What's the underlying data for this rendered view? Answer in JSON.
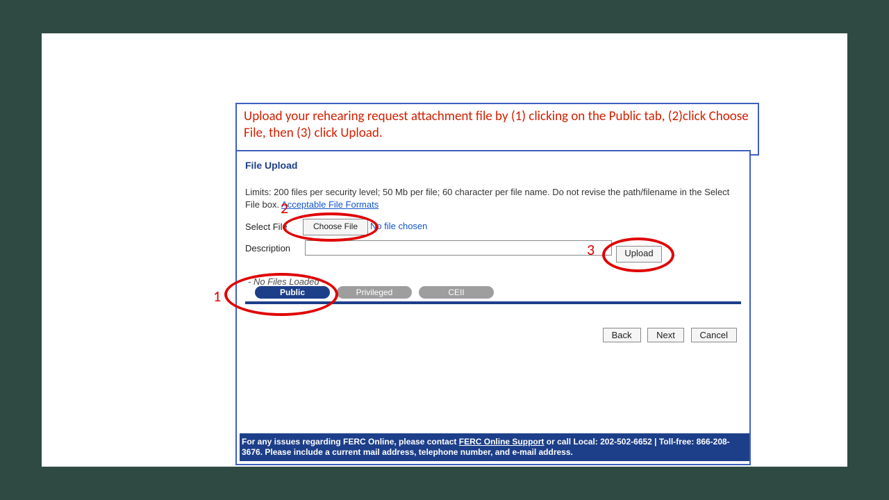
{
  "instruction": "Upload your rehearing request attachment file by (1) clicking on the Public tab, (2)click Choose File, then (3) click Upload.",
  "panel": {
    "title": "File Upload",
    "limits_prefix": "Limits: 200 files per security level; 50 Mb per file; 60 character per file name. Do not revise the path/filename in the Select File box. ",
    "acceptable_link": "Acceptable File Formats",
    "select_file_label": "Select File",
    "choose_file_btn": "Choose File",
    "no_file_text": "No file chosen",
    "description_label": "Description",
    "upload_btn": "Upload",
    "no_files_loaded": "- No Files Loaded -",
    "tabs": {
      "public": "Public",
      "privileged": "Privileged",
      "ceii": "CEII"
    },
    "nav": {
      "back": "Back",
      "next": "Next",
      "cancel": "Cancel"
    }
  },
  "footer": {
    "pre": "For any issues regarding FERC Online, please contact ",
    "link": "FERC Online Support",
    "post": " or call Local: 202-502-6652 | Toll-free: 866-208-3676. Please include a current mail address, telephone number, and e-mail address."
  },
  "annotations": {
    "one": "1",
    "two": "2",
    "three": "3"
  }
}
